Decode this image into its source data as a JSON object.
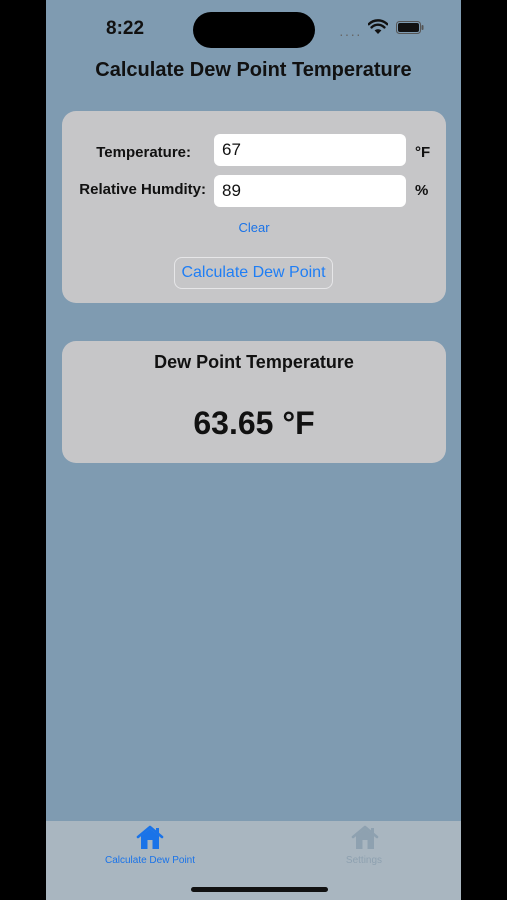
{
  "status_bar": {
    "time": "8:22",
    "signal_dots": "····"
  },
  "header": {
    "title": "Calculate Dew Point Temperature"
  },
  "form": {
    "temperature_label": "Temperature:",
    "temperature_value": "67",
    "temperature_unit": "°F",
    "humidity_label": "Relative Humdity:",
    "humidity_value": "89",
    "humidity_unit": "%",
    "clear_label": "Clear",
    "calculate_label": "Calculate Dew Point"
  },
  "result": {
    "title": "Dew Point Temperature",
    "value": "63.65 °F"
  },
  "tabs": [
    {
      "label": "Calculate Dew Point",
      "icon": "house-icon",
      "active": true
    },
    {
      "label": "Settings",
      "icon": "house-icon",
      "active": false
    }
  ],
  "colors": {
    "background": "#7f9bb1",
    "card": "#c6c6c8",
    "accent": "#1a73e8",
    "tab_bar": "#a9b6c0"
  }
}
